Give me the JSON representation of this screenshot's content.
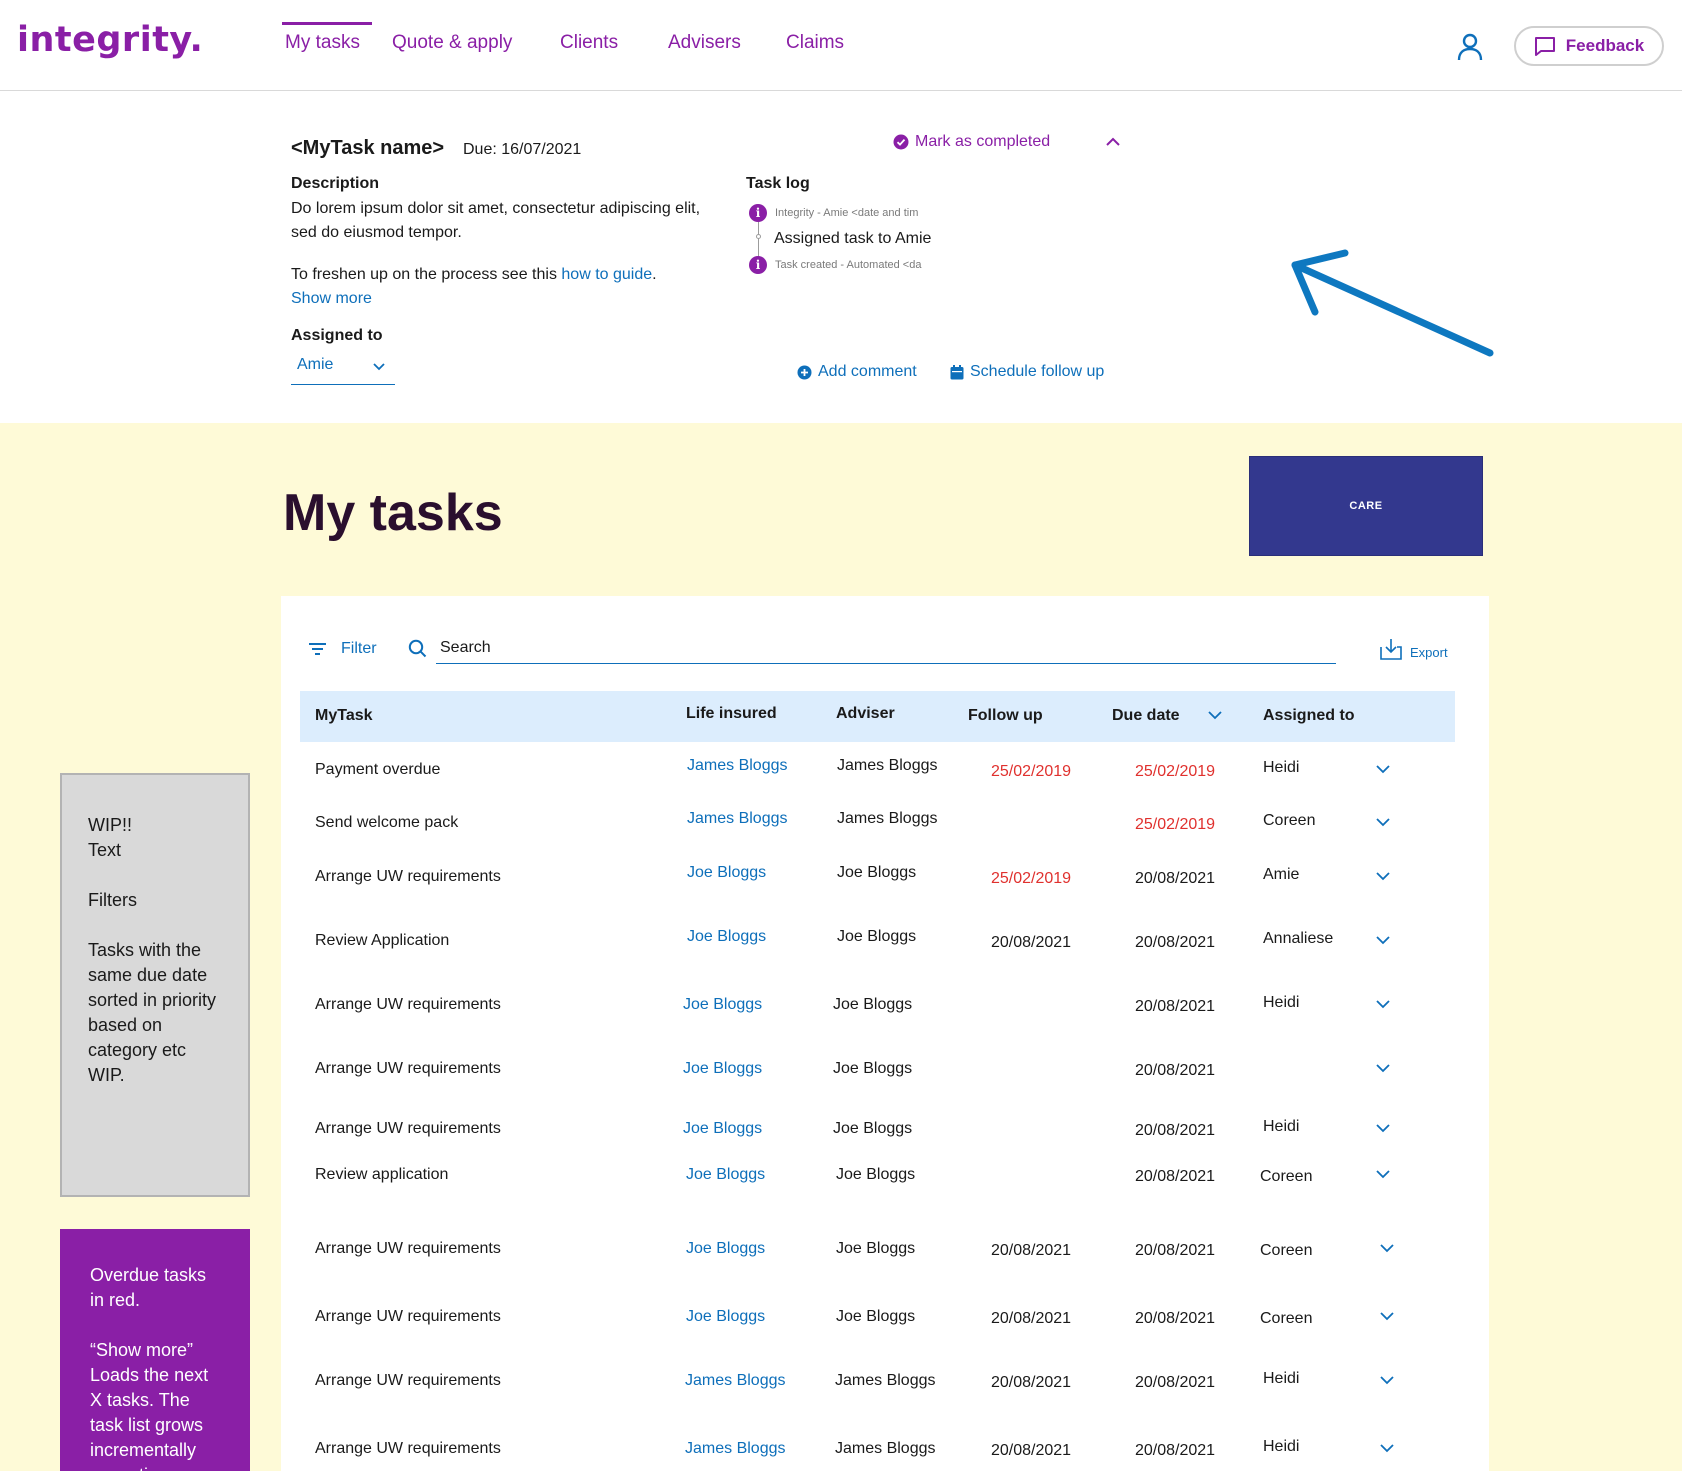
{
  "header": {
    "logo": "integrity.",
    "nav": [
      {
        "label": "My tasks",
        "active": true
      },
      {
        "label": "Quote & apply",
        "active": false
      },
      {
        "label": "Clients",
        "active": false
      },
      {
        "label": "Advisers",
        "active": false
      },
      {
        "label": "Claims",
        "active": false
      }
    ],
    "feedback_label": "Feedback"
  },
  "task_detail": {
    "title": "<MyTask name>",
    "due": "Due: 16/07/2021",
    "mark_completed": "Mark as completed",
    "description_heading": "Description",
    "description_text": "Do lorem ipsum dolor sit amet, consectetur adipiscing elit, sed do eiusmod tempor.",
    "freshen_prefix": "To freshen up on the process see this ",
    "freshen_link": "how to guide",
    "freshen_suffix": ".",
    "show_more": "Show more",
    "assigned_heading": "Assigned to",
    "assigned_value": "Amie",
    "task_log_heading": "Task log",
    "log_entries": [
      {
        "meta": "Integrity - Amie <date and tim",
        "text": "Assigned task to Amie"
      },
      {
        "meta": "Task created - Automated <da",
        "text": ""
      }
    ],
    "add_comment": "Add comment",
    "schedule_follow_up": "Schedule follow up"
  },
  "main": {
    "title": "My tasks",
    "care_label": "CARE",
    "wip_note": "WIP!!\nText\n\nFilters\n\nTasks with the same due date sorted in priority based on category etc WIP.",
    "overdue_note": "Overdue tasks in red.\n\n“Show more” Loads the next X tasks. The task list grows incrementally every time you",
    "filter_label": "Filter",
    "search_placeholder": "Search",
    "export_label": "Export",
    "columns": [
      "MyTask",
      "Life insured",
      "Adviser",
      "Follow up",
      "Due date",
      "Assigned to"
    ],
    "rows": [
      {
        "task": "Payment overdue",
        "life": "James Bloggs",
        "adviser": "James Bloggs",
        "follow": "25/02/2019",
        "follow_overdue": true,
        "due": "25/02/2019",
        "due_overdue": true,
        "assigned": "Heidi"
      },
      {
        "task": "Send welcome pack",
        "life": "James Bloggs",
        "adviser": "James Bloggs",
        "follow": "",
        "follow_overdue": false,
        "due": "25/02/2019",
        "due_overdue": true,
        "assigned": "Coreen"
      },
      {
        "task": "Arrange UW requirements",
        "life": "Joe Bloggs",
        "adviser": "Joe Bloggs",
        "follow": "25/02/2019",
        "follow_overdue": true,
        "due": "20/08/2021",
        "due_overdue": false,
        "assigned": "Amie"
      },
      {
        "task": "Review Application",
        "life": "Joe Bloggs",
        "adviser": "Joe Bloggs",
        "follow": "20/08/2021",
        "follow_overdue": false,
        "due": "20/08/2021",
        "due_overdue": false,
        "assigned": "Annaliese"
      },
      {
        "task": "Arrange UW requirements",
        "life": "Joe Bloggs",
        "adviser": "Joe Bloggs",
        "follow": "",
        "follow_overdue": false,
        "due": "20/08/2021",
        "due_overdue": false,
        "assigned": "Heidi"
      },
      {
        "task": "Arrange UW requirements",
        "life": "Joe Bloggs",
        "adviser": "Joe Bloggs",
        "follow": "",
        "follow_overdue": false,
        "due": "20/08/2021",
        "due_overdue": false,
        "assigned": ""
      },
      {
        "task": "Arrange UW requirements",
        "life": "Joe Bloggs",
        "adviser": "Joe Bloggs",
        "follow": "",
        "follow_overdue": false,
        "due": "20/08/2021",
        "due_overdue": false,
        "assigned": "Heidi"
      },
      {
        "task": "Review application",
        "life": "Joe Bloggs",
        "adviser": "Joe Bloggs",
        "follow": "",
        "follow_overdue": false,
        "due": "20/08/2021",
        "due_overdue": false,
        "assigned": "Coreen"
      },
      {
        "task": "Arrange UW requirements",
        "life": "Joe Bloggs",
        "adviser": "Joe Bloggs",
        "follow": "20/08/2021",
        "follow_overdue": false,
        "due": "20/08/2021",
        "due_overdue": false,
        "assigned": "Coreen"
      },
      {
        "task": "Arrange UW requirements",
        "life": "Joe Bloggs",
        "adviser": "Joe Bloggs",
        "follow": "20/08/2021",
        "follow_overdue": false,
        "due": "20/08/2021",
        "due_overdue": false,
        "assigned": "Coreen"
      },
      {
        "task": "Arrange UW requirements",
        "life": "James Bloggs",
        "adviser": "James Bloggs",
        "follow": "20/08/2021",
        "follow_overdue": false,
        "due": "20/08/2021",
        "due_overdue": false,
        "assigned": "Heidi"
      },
      {
        "task": "Arrange UW requirements",
        "life": "James Bloggs",
        "adviser": "James Bloggs",
        "follow": "20/08/2021",
        "follow_overdue": false,
        "due": "20/08/2021",
        "due_overdue": false,
        "assigned": "Heidi"
      }
    ]
  },
  "colors": {
    "brand_purple": "#8a1fa6",
    "link_blue": "#0e6fba",
    "overdue_red": "#e0312e",
    "care_navy": "#33388e",
    "yellow_bg": "#fefad7"
  },
  "icons": [
    "user-icon",
    "chat-bubble-icon",
    "check-circle-icon",
    "chevron-up-icon",
    "chevron-down-icon",
    "info-icon",
    "plus-circle-icon",
    "calendar-icon",
    "filter-icon",
    "search-icon",
    "download-icon",
    "arrow-icon"
  ]
}
